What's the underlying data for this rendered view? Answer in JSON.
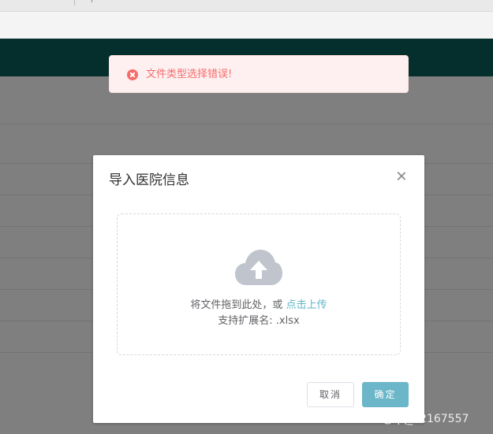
{
  "toast": {
    "message": "文件类型选择错误!",
    "icon": "error-circle-icon",
    "color": "#f56c6c"
  },
  "dialog": {
    "title": "导入医院信息",
    "upload": {
      "icon": "cloud-upload-icon",
      "hint_prefix": "将文件拖到此处，或",
      "hint_link": "点击上传",
      "tip": "支持扩展名: .xlsx"
    },
    "cancel_label": "取消",
    "confirm_label": "确定"
  },
  "colors": {
    "header": "#0a5e59",
    "accent": "#6bb6c8",
    "error": "#f56c6c"
  },
  "watermark": "CSDN @qq_22167557"
}
